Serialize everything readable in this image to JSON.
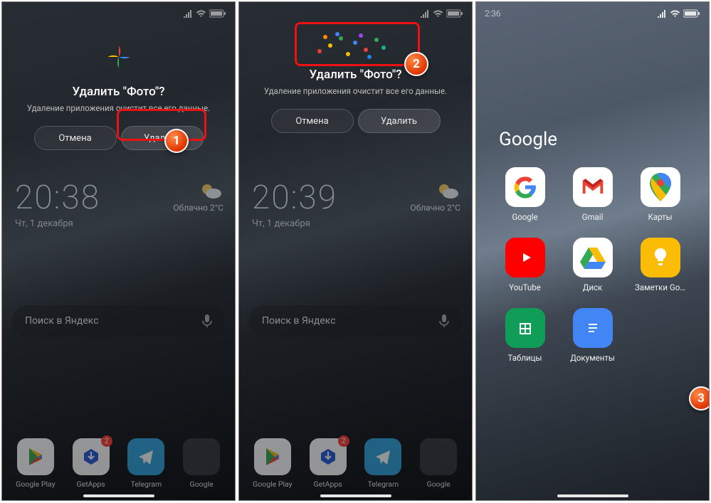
{
  "screen1": {
    "statusbar_time": "",
    "dialog": {
      "title": "Удалить \"Фото\"?",
      "subtitle": "Удаление приложения очистит все его данные.",
      "cancel": "Отмена",
      "confirm": "Удалить"
    },
    "clock_time": "20:38",
    "clock_date": "Чт, 1 декабря",
    "weather_text": "Облачно  2°C",
    "search_placeholder": "Поиск в Яндекс",
    "dock": [
      {
        "label": "Google Play",
        "bg": "#fff",
        "badge": null,
        "icon": "play"
      },
      {
        "label": "GetApps",
        "bg": "#fff",
        "badge": "2",
        "icon": "getapps"
      },
      {
        "label": "Telegram",
        "bg": "#2fa3dd",
        "badge": null,
        "icon": "telegram"
      },
      {
        "label": "Google",
        "bg": "#303238",
        "badge": null,
        "icon": "folder"
      }
    ]
  },
  "screen2": {
    "dialog": {
      "title": "Удалить \"Фото\"?",
      "subtitle": "Удаление приложения очистит все его данные.",
      "cancel": "Отмена",
      "confirm": "Удалить"
    },
    "clock_time": "20:39",
    "clock_date": "Чт, 1 декабря",
    "weather_text": "Облачно  2°C",
    "search_placeholder": "Поиск в Яндекс",
    "dock": [
      {
        "label": "Google Play",
        "bg": "#fff",
        "badge": null,
        "icon": "play"
      },
      {
        "label": "GetApps",
        "bg": "#fff",
        "badge": "2",
        "icon": "getapps"
      },
      {
        "label": "Telegram",
        "bg": "#2fa3dd",
        "badge": null,
        "icon": "telegram"
      },
      {
        "label": "Google",
        "bg": "#303238",
        "badge": null,
        "icon": "folder"
      }
    ]
  },
  "screen3": {
    "statusbar_time": "2:36",
    "folder_title": "Google",
    "apps": [
      {
        "label": "Google",
        "icon": "google"
      },
      {
        "label": "Gmail",
        "icon": "gmail"
      },
      {
        "label": "Карты",
        "icon": "maps"
      },
      {
        "label": "YouTube",
        "icon": "youtube"
      },
      {
        "label": "Диск",
        "icon": "drive"
      },
      {
        "label": "Заметки Go…",
        "icon": "keep"
      },
      {
        "label": "Таблицы",
        "icon": "sheets"
      },
      {
        "label": "Документы",
        "icon": "docs"
      }
    ]
  },
  "steps": {
    "s1": "1",
    "s2": "2",
    "s3": "3"
  }
}
